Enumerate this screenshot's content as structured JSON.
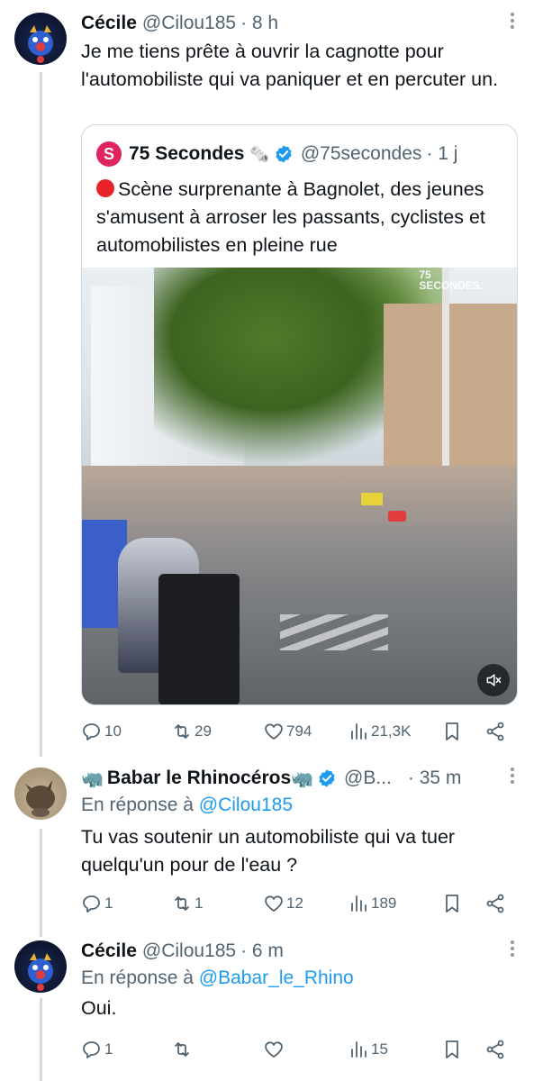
{
  "tweets": [
    {
      "name": "Cécile",
      "handle": "@Cilou185",
      "time": "· 8 h",
      "text": "Je me tiens prête à ouvrir la cagnotte pour l'automobiliste qui va paniquer et en percuter un.",
      "quote": {
        "logo_letter": "S",
        "name": "75 Secondes",
        "name_emoji": "🗞️",
        "handle": "@75secondes",
        "time": "· 1 j",
        "text": "Scène surprenante à Bagnolet, des jeunes s'amusent à arroser les passants, cyclistes et automobilistes en pleine rue",
        "video_watermark_top": "75",
        "video_watermark_bottom": "SECONDES."
      },
      "stats": {
        "replies": "10",
        "retweets": "29",
        "likes": "794",
        "views": "21,3K"
      }
    },
    {
      "name": "Babar le Rhinocéros",
      "name_prefix_emoji": "🦏",
      "name_suffix_emoji": "🦏",
      "handle": "@B...",
      "time": "· 35 m",
      "reply_prefix": "En réponse à",
      "reply_to": "@Cilou185",
      "text": "Tu vas soutenir un automobiliste qui va tuer quelqu'un pour de l'eau ?",
      "stats": {
        "replies": "1",
        "retweets": "1",
        "likes": "12",
        "views": "189"
      }
    },
    {
      "name": "Cécile",
      "handle": "@Cilou185",
      "time": "· 6 m",
      "reply_prefix": "En réponse à",
      "reply_to": "@Babar_le_Rhino",
      "text": "Oui.",
      "stats": {
        "replies": "1",
        "retweets": "",
        "likes": "",
        "views": "15"
      }
    }
  ],
  "colors": {
    "link": "#1d9bf0",
    "muted": "#536471",
    "verified": "#1d9bf0",
    "border": "#cfd9de"
  }
}
